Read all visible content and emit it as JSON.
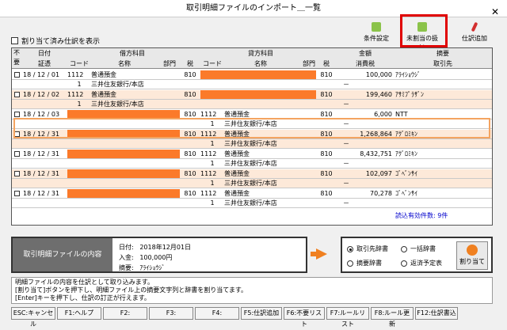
{
  "window": {
    "title": "取引明細ファイルのインポート＿一覧",
    "close_symbol": "✕"
  },
  "options": {
    "show_assigned_label": "割り当て済み仕訳を表示"
  },
  "toolbar": {
    "condition": "条件設定",
    "unassigned": "未割当の扱い",
    "add_entry": "仕訳追加"
  },
  "grid": {
    "headers": {
      "unneeded": "不要",
      "date": "日付",
      "voucher": "証憑",
      "debit": "借方科目",
      "credit": "貸方科目",
      "code": "コード",
      "name": "名称",
      "dept": "部門",
      "tax": "税",
      "amount": "金額",
      "tax_amount": "消費税",
      "summary": "摘要",
      "partner": "取引先"
    },
    "entries": [
      {
        "date": "18 / 12 / 01",
        "d_code": "1112",
        "d_name": "普通預金",
        "d_tax": "810",
        "c_code": "",
        "c_name": "",
        "c_tax": "810",
        "amount": "100,000",
        "summary": "ｱﾗｲｼｮｳｼﾞ",
        "sub_d_code": "1",
        "sub_d_name": "三井住友銀行/本店",
        "sub_c_code": "",
        "sub_c_name": "",
        "sub_mark": "－"
      },
      {
        "date": "18 / 12 / 02",
        "d_code": "1112",
        "d_name": "普通預金",
        "d_tax": "810",
        "c_code": "",
        "c_name": "",
        "c_tax": "810",
        "amount": "199,460",
        "summary": "ｱｻﾐﾌﾟﾗｻﾞﾝ",
        "sub_d_code": "1",
        "sub_d_name": "三井住友銀行/本店",
        "sub_c_code": "",
        "sub_c_name": "",
        "sub_mark": "－"
      },
      {
        "date": "18 / 12 / 03",
        "d_code": "",
        "d_name": "",
        "d_tax": "810",
        "c_code": "1112",
        "c_name": "普通預金",
        "c_tax": "810",
        "amount": "6,000",
        "summary": "NTT",
        "sub_d_code": "",
        "sub_d_name": "",
        "sub_c_code": "1",
        "sub_c_name": "三井住友銀行/本店",
        "sub_mark": "－"
      },
      {
        "date": "18 / 12 / 31",
        "d_code": "",
        "d_name": "",
        "d_tax": "810",
        "c_code": "1112",
        "c_name": "普通預金",
        "c_tax": "810",
        "amount": "1,268,864",
        "summary": "ｱｸﾞﾛﾐｷﾝ",
        "sub_d_code": "",
        "sub_d_name": "",
        "sub_c_code": "1",
        "sub_c_name": "三井住友銀行/本店",
        "sub_mark": "－"
      },
      {
        "date": "18 / 12 / 31",
        "d_code": "",
        "d_name": "",
        "d_tax": "810",
        "c_code": "1112",
        "c_name": "普通預金",
        "c_tax": "810",
        "amount": "8,432,751",
        "summary": "ｱｸﾞﾛﾐｷﾝ",
        "sub_d_code": "",
        "sub_d_name": "",
        "sub_c_code": "1",
        "sub_c_name": "三井住友銀行/本店",
        "sub_mark": "－"
      },
      {
        "date": "18 / 12 / 31",
        "d_code": "",
        "d_name": "",
        "d_tax": "810",
        "c_code": "1112",
        "c_name": "普通預金",
        "c_tax": "810",
        "amount": "102,097",
        "summary": "ｺﾞﾍﾞﾝｻｲ",
        "sub_d_code": "",
        "sub_d_name": "",
        "sub_c_code": "1",
        "sub_c_name": "三井住友銀行/本店",
        "sub_mark": "－"
      },
      {
        "date": "18 / 12 / 31",
        "d_code": "",
        "d_name": "",
        "d_tax": "810",
        "c_code": "1112",
        "c_name": "普通預金",
        "c_tax": "810",
        "amount": "70,278",
        "summary": "ｺﾞﾍﾞﾝｻｲ",
        "sub_d_code": "",
        "sub_d_name": "",
        "sub_c_code": "1",
        "sub_c_name": "三井住友銀行/本店",
        "sub_mark": "－"
      }
    ],
    "count_label": "読込有効件数: 9件"
  },
  "info": {
    "title": "取引明細ファイルの内容",
    "date_label": "日付:",
    "date_value": "2018年12月01日",
    "deposit_label": "入金:",
    "deposit_value": "100,000円",
    "summary_label": "摘要:",
    "summary_value": "ｱﾗｲｼｮｳｼﾞ"
  },
  "dict": {
    "partner_dict": "取引先辞書",
    "bulk_dict": "一括辞書",
    "summary_dict": "摘要辞書",
    "repay_table": "返済予定表",
    "assign_button": "割り当て"
  },
  "message": [
    "明細ファイルの内容を仕訳として取り込みます。",
    "[割り当て]ボタンを押下し、明細ファイル上の摘要文字列と辞書を割り当てます。",
    "[Enter]キーを押下し、仕訳の訂正が行えます。"
  ],
  "fkeys": [
    "ESC:キャンセル",
    "F1:ヘルプ",
    "F2:",
    "F3:",
    "F4:",
    "F5:仕訳追加",
    "F6:不要リスト",
    "F7:ルールリスト",
    "F8:ルール更新",
    "F12:仕訳書込"
  ],
  "colors": {
    "orange": "#fb7a2a",
    "pink": "#fde9d9",
    "highlight": "#e00000",
    "link": "#0000cc"
  }
}
